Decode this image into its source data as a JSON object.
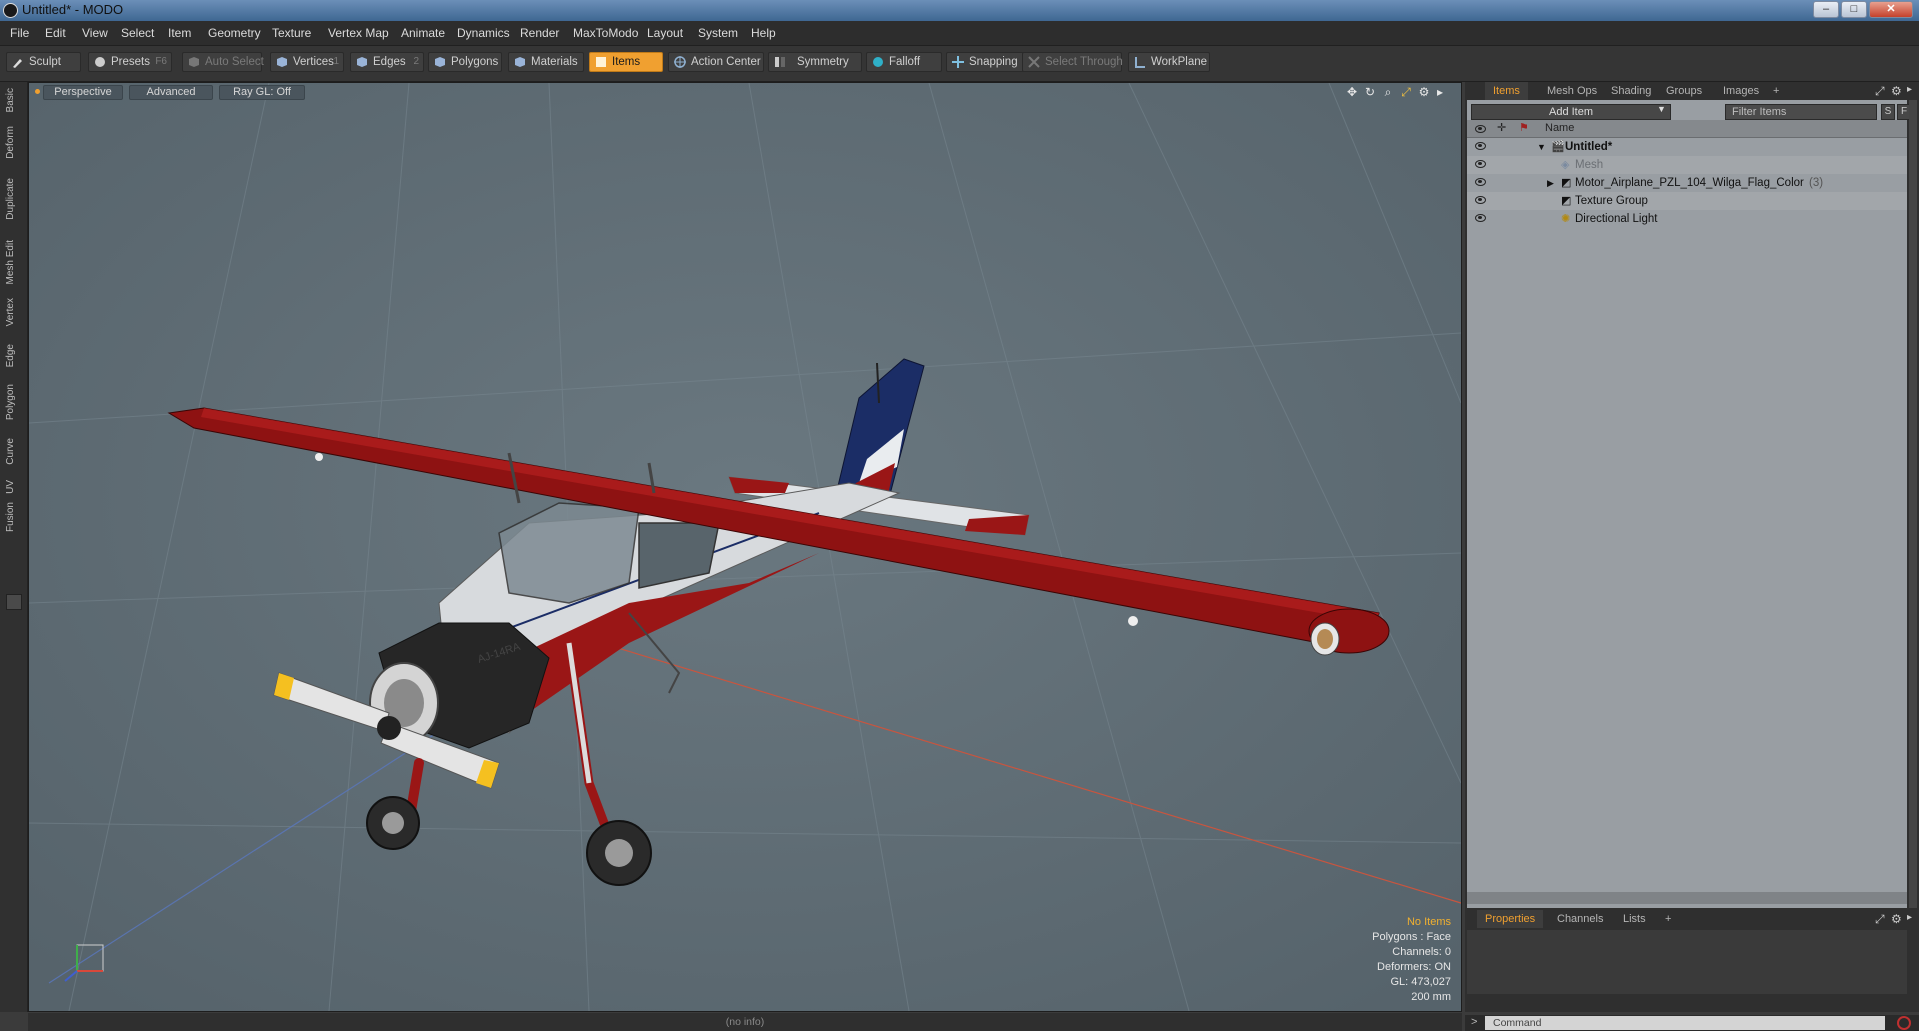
{
  "window": {
    "title": "Untitled* - MODO",
    "minimize_glyph": "–",
    "maximize_glyph": "□",
    "close_glyph": "✕"
  },
  "menu": [
    "File",
    "Edit",
    "View",
    "Select",
    "Item",
    "Geometry",
    "Texture",
    "Vertex Map",
    "Animate",
    "Dynamics",
    "Render",
    "MaxToModo",
    "Layout",
    "System",
    "Help"
  ],
  "toolbar": {
    "sculpt": "Sculpt",
    "presets": "Presets",
    "presets_key": "F6",
    "auto_select": "Auto Select",
    "vertices": "Vertices",
    "vertices_key": "1",
    "edges": "Edges",
    "edges_key": "2",
    "polygons": "Polygons",
    "materials": "Materials",
    "items": "Items",
    "action_center": "Action Center",
    "symmetry": "Symmetry",
    "falloff": "Falloff",
    "snapping": "Snapping",
    "select_through": "Select Through",
    "workplane": "WorkPlane"
  },
  "left_tabs": [
    "Basic",
    "Deform",
    "Duplicate",
    "Mesh Edit",
    "Vertex",
    "Edge",
    "Polygon",
    "Curve",
    "UV",
    "Fusion"
  ],
  "viewport": {
    "view": "Perspective",
    "shading": "Advanced",
    "raygl": "Ray GL: Off",
    "stats": {
      "selection": "No Items",
      "polygons": "Polygons : Face",
      "channels": "Channels: 0",
      "deformers": "Deformers: ON",
      "gl": "GL: 473,027",
      "scale": "200 mm"
    },
    "plane_label": "AJ-14RA"
  },
  "items_panel": {
    "tabs": [
      "Items",
      "Mesh Ops",
      "Shading",
      "Groups",
      "Images",
      "+"
    ],
    "add_item": "Add Item",
    "filter_placeholder": "Filter Items",
    "s_btn": "S",
    "f_btn": "F",
    "col_name": "Name",
    "rows": [
      {
        "name": "Untitled*",
        "count": ""
      },
      {
        "name": "Mesh",
        "count": ""
      },
      {
        "name": "Motor_Airplane_PZL_104_Wilga_Flag_Color",
        "count": "(3)"
      },
      {
        "name": "Texture Group",
        "count": ""
      },
      {
        "name": "Directional Light",
        "count": ""
      }
    ]
  },
  "props_panel": {
    "tabs": [
      "Properties",
      "Channels",
      "Lists",
      "+"
    ]
  },
  "command": {
    "prompt": ">",
    "placeholder": "Command"
  },
  "status": "(no info)",
  "colors": {
    "accent": "#f0a030",
    "viewport_bg": "#5d6b74",
    "plane_red": "#8e1212"
  }
}
